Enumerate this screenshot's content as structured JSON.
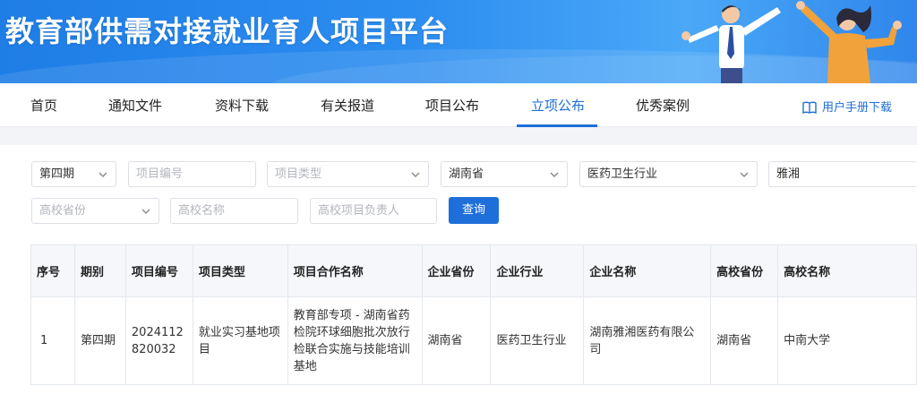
{
  "header": {
    "title": "教育部供需对接就业育人项目平台"
  },
  "nav": {
    "items": [
      {
        "label": "首页"
      },
      {
        "label": "通知文件"
      },
      {
        "label": "资料下载"
      },
      {
        "label": "有关报道"
      },
      {
        "label": "项目公布"
      },
      {
        "label": "立项公布"
      },
      {
        "label": "优秀案例"
      }
    ],
    "active": "立项公布",
    "manual_label": "用户手册下载"
  },
  "filters": {
    "period": "第四期",
    "project_no_placeholder": "项目编号",
    "project_type_placeholder": "项目类型",
    "province": "湖南省",
    "industry": "医药卫生行业",
    "company": "雅湘",
    "school_province_placeholder": "高校省份",
    "school_name_placeholder": "高校名称",
    "school_leader_placeholder": "高校项目负责人",
    "search_label": "查询"
  },
  "table": {
    "headers": [
      "序号",
      "期别",
      "项目编号",
      "项目类型",
      "项目合作名称",
      "企业省份",
      "企业行业",
      "企业名称",
      "高校省份",
      "高校名称"
    ],
    "rows": [
      [
        "1",
        "第四期",
        "2024112820032",
        "就业实习基地项目",
        "教育部专项 - 湖南省药检院环球细胞批次放行检联合实施与技能培训基地",
        "湖南省",
        "医药卫生行业",
        "湖南雅湘医药有限公司",
        "湖南省",
        "中南大学"
      ]
    ]
  },
  "colors": {
    "accent": "#1e6fd9",
    "banner": "#2c8df0"
  },
  "icons": {
    "manual": "book-icon",
    "dropdown": "chevron-down-icon"
  }
}
